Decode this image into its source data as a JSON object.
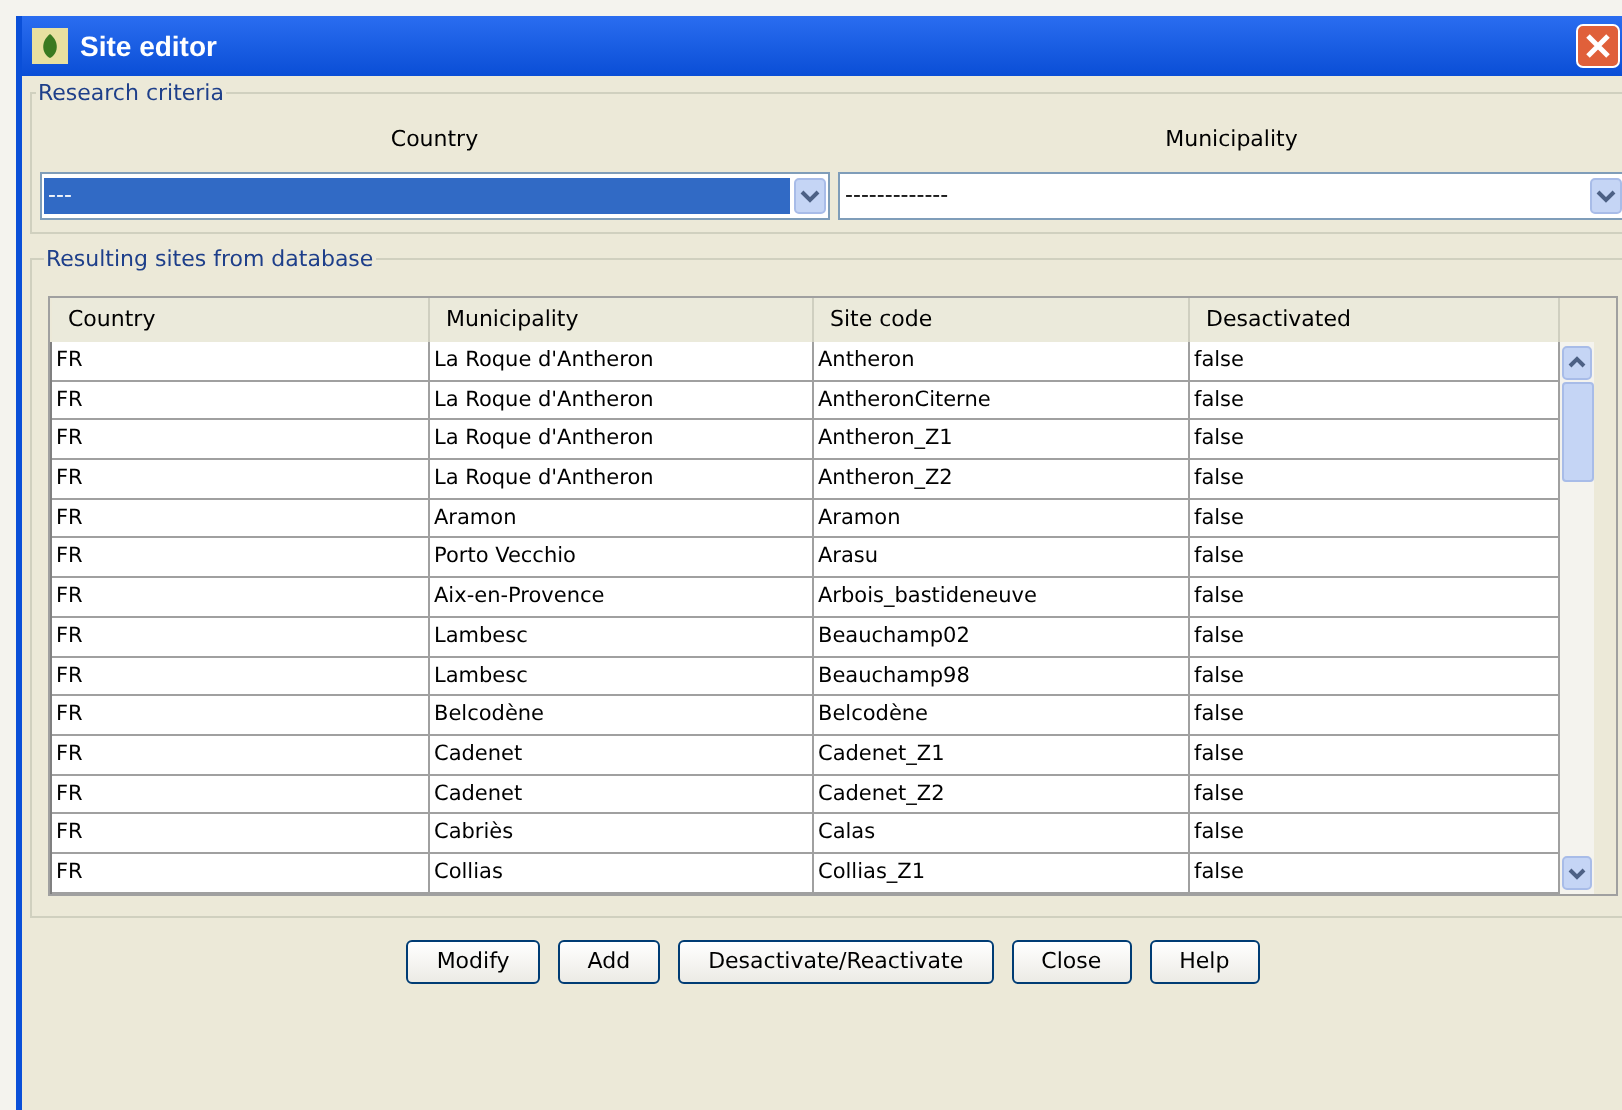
{
  "window": {
    "title": "Site editor"
  },
  "research_criteria": {
    "legend": "Research criteria",
    "country": {
      "label": "Country",
      "value": "---",
      "selected": true
    },
    "municipality": {
      "label": "Municipality",
      "value": "-------------",
      "selected": false
    }
  },
  "results": {
    "legend": "Resulting sites from database",
    "table": {
      "columns": [
        "Country",
        "Municipality",
        "Site code",
        "Desactivated"
      ],
      "rows": [
        [
          "FR",
          "La Roque d'Antheron",
          "Antheron",
          "false"
        ],
        [
          "FR",
          "La Roque d'Antheron",
          "AntheronCiterne",
          "false"
        ],
        [
          "FR",
          "La Roque d'Antheron",
          "Antheron_Z1",
          "false"
        ],
        [
          "FR",
          "La Roque d'Antheron",
          "Antheron_Z2",
          "false"
        ],
        [
          "FR",
          "Aramon",
          "Aramon",
          "false"
        ],
        [
          "FR",
          "Porto Vecchio",
          "Arasu",
          "false"
        ],
        [
          "FR",
          "Aix-en-Provence",
          "Arbois_bastideneuve",
          "false"
        ],
        [
          "FR",
          "Lambesc",
          "Beauchamp02",
          "false"
        ],
        [
          "FR",
          "Lambesc",
          "Beauchamp98",
          "false"
        ],
        [
          "FR",
          "Belcodène",
          "Belcodène",
          "false"
        ],
        [
          "FR",
          "Cadenet",
          "Cadenet_Z1",
          "false"
        ],
        [
          "FR",
          "Cadenet",
          "Cadenet_Z2",
          "false"
        ],
        [
          "FR",
          "Cabriès",
          "Calas",
          "false"
        ],
        [
          "FR",
          "Collias",
          "Collias_Z1",
          "false"
        ]
      ]
    }
  },
  "buttons": [
    "Modify",
    "Add",
    "Desactivate/Reactivate",
    "Close",
    "Help"
  ]
}
